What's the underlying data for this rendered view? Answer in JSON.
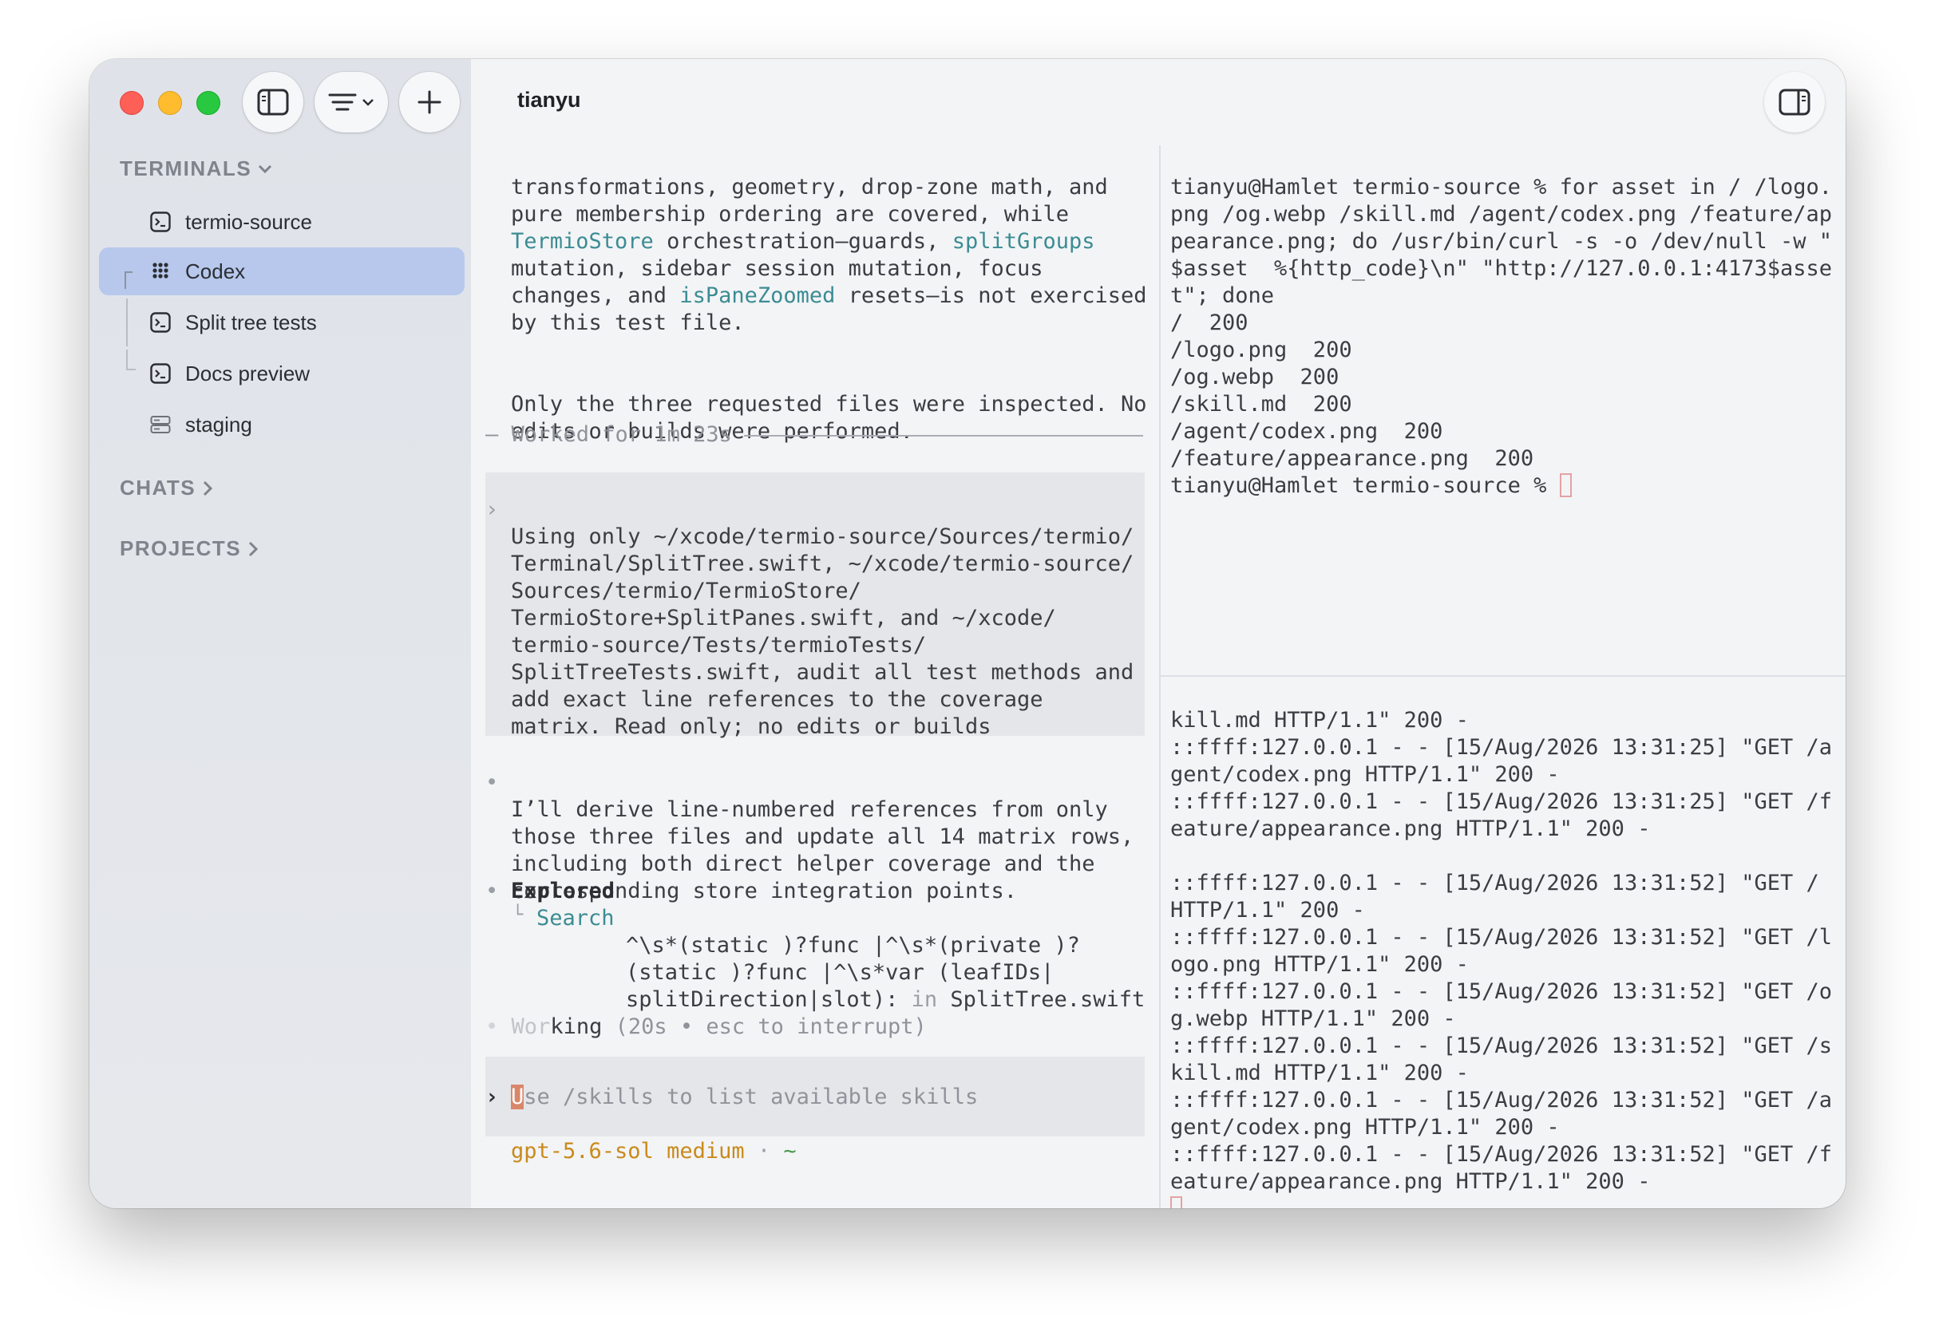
{
  "window": {
    "title": "tianyu"
  },
  "sidebar": {
    "sections": {
      "terminals": "TERMINALS",
      "chats": "CHATS",
      "projects": "PROJECTS"
    },
    "items": [
      {
        "label": "termio-source",
        "icon": "terminal-icon"
      },
      {
        "label": "Codex",
        "icon": "grid-icon",
        "selected": true
      },
      {
        "label": "Split tree tests",
        "icon": "terminal-icon"
      },
      {
        "label": "Docs preview",
        "icon": "terminal-icon"
      },
      {
        "label": "staging",
        "icon": "server-icon"
      }
    ]
  },
  "left_pane": {
    "para1": [
      "transformations, geometry, drop-zone math, and",
      "pure membership ordering are covered, while",
      [
        "TermioStore",
        " orchestration—guards, ",
        "splitGroups"
      ],
      "mutation, sidebar session mutation, focus",
      [
        "changes, and ",
        "isPaneZoomed",
        " resets—is not exercised"
      ],
      "by this test file."
    ],
    "para2": [
      "Only the three requested files were inspected. No",
      "edits or builds were performed."
    ],
    "worked_for": "Worked for 1m 23s",
    "prompt_lines": [
      "Using only ~/xcode/termio-source/Sources/termio/",
      "Terminal/SplitTree.swift, ~/xcode/termio-source/",
      "Sources/termio/TermioStore/",
      "TermioStore+SplitPanes.swift, and ~/xcode/",
      "termio-source/Tests/termioTests/",
      "SplitTreeTests.swift, audit all test methods and",
      "add exact line references to the coverage",
      "matrix. Read only; no edits or builds"
    ],
    "reply_lines": [
      "I’ll derive line-numbered references from only",
      "those three files and update all 14 matrix rows,",
      "including both direct helper coverage and the",
      "corresponding store integration points."
    ],
    "explored_label": "Explored",
    "search_label": "Search",
    "search_lines": [
      "^\\s*(static )?func |^\\s*(private )?",
      "(static )?func |^\\s*var (leafIDs|",
      "splitDirection|slot):"
    ],
    "search_in": "in",
    "search_file": "SplitTree.swift",
    "working_a": "Wor",
    "working_b": "king",
    "working_status": "(20s • esc to interrupt)",
    "input_cursor": "U",
    "input_placeholder": "se /skills to list available skills",
    "model": "gpt-5.6-sol medium",
    "model_sep": "·",
    "model_dir": "~"
  },
  "right_top": {
    "lines": [
      "tianyu@Hamlet termio-source % for asset in / /logo.",
      "png /og.webp /skill.md /agent/codex.png /feature/ap",
      "pearance.png; do /usr/bin/curl -s -o /dev/null -w \"",
      "$asset  %{http_code}\\n\" \"http://127.0.0.1:4173$asse",
      "t\"; done",
      "/  200",
      "/logo.png  200",
      "/og.webp  200",
      "/skill.md  200",
      "/agent/codex.png  200",
      "/feature/appearance.png  200"
    ],
    "prompt": "tianyu@Hamlet termio-source % "
  },
  "right_bottom": {
    "lines": [
      "kill.md HTTP/1.1\" 200 -",
      "::ffff:127.0.0.1 - - [15/Aug/2026 13:31:25] \"GET /a",
      "gent/codex.png HTTP/1.1\" 200 -",
      "::ffff:127.0.0.1 - - [15/Aug/2026 13:31:25] \"GET /f",
      "eature/appearance.png HTTP/1.1\" 200 -",
      "",
      "::ffff:127.0.0.1 - - [15/Aug/2026 13:31:52] \"GET /",
      "HTTP/1.1\" 200 -",
      "::ffff:127.0.0.1 - - [15/Aug/2026 13:31:52] \"GET /l",
      "ogo.png HTTP/1.1\" 200 -",
      "::ffff:127.0.0.1 - - [15/Aug/2026 13:31:52] \"GET /o",
      "g.webp HTTP/1.1\" 200 -",
      "::ffff:127.0.0.1 - - [15/Aug/2026 13:31:52] \"GET /s",
      "kill.md HTTP/1.1\" 200 -",
      "::ffff:127.0.0.1 - - [15/Aug/2026 13:31:52] \"GET /a",
      "gent/codex.png HTTP/1.1\" 200 -",
      "::ffff:127.0.0.1 - - [15/Aug/2026 13:31:52] \"GET /f",
      "eature/appearance.png HTTP/1.1\" 200 -"
    ]
  },
  "colors": {
    "accent_teal": "#3b8c93",
    "selection": "#b7c8ec",
    "model_orange": "#c98a1a"
  }
}
